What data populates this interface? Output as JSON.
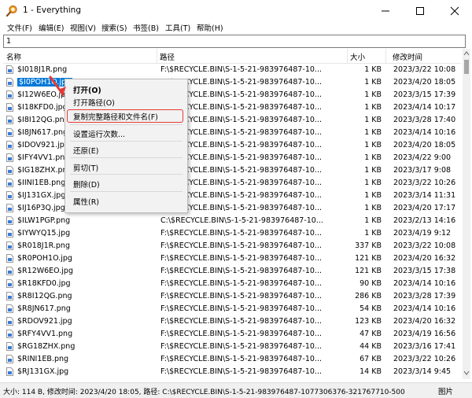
{
  "window": {
    "title": "1 - Everything"
  },
  "menu": [
    "文件(F)",
    "编辑(E)",
    "视图(V)",
    "搜索(S)",
    "书签(B)",
    "工具(T)",
    "帮助(H)"
  ],
  "search": {
    "value": "1"
  },
  "columns": {
    "name": "名称",
    "path": "路径",
    "size": "大小",
    "modified": "修改时间"
  },
  "rows": [
    {
      "name": "$I018J1R.png",
      "path": "F:\\$RECYCLE.BIN\\S-1-5-21-983976487-10...",
      "size": "1 KB",
      "date": "2023/3/22 10:08"
    },
    {
      "name": "$I0POH1O.jpg",
      "path": "F:\\$RECYCLE.BIN\\S-1-5-21-983976487-10...",
      "size": "1 KB",
      "date": "2023/4/20 18:05",
      "selected": true
    },
    {
      "name": "$I12W6EO.jpg",
      "path": "F:\\$RECYCLE.BIN\\S-1-5-21-983976487-10...",
      "size": "1 KB",
      "date": "2023/3/15 17:39"
    },
    {
      "name": "$I18KFD0.jpg",
      "path": "F:\\$RECYCLE.BIN\\S-1-5-21-983976487-10...",
      "size": "1 KB",
      "date": "2023/4/14 10:17"
    },
    {
      "name": "$I8I12QG.png",
      "path": "F:\\$RECYCLE.BIN\\S-1-5-21-983976487-10...",
      "size": "1 KB",
      "date": "2023/3/28 17:40"
    },
    {
      "name": "$I8JN617.png",
      "path": "F:\\$RECYCLE.BIN\\S-1-5-21-983976487-10...",
      "size": "1 KB",
      "date": "2023/4/14 10:16"
    },
    {
      "name": "$IDOV921.jpg",
      "path": "F:\\$RECYCLE.BIN\\S-1-5-21-983976487-10...",
      "size": "1 KB",
      "date": "2023/4/20 18:05"
    },
    {
      "name": "$IFY4VV1.png",
      "path": "F:\\$RECYCLE.BIN\\S-1-5-21-983976487-10...",
      "size": "1 KB",
      "date": "2023/4/22 9:00"
    },
    {
      "name": "$IG18ZHX.png",
      "path": "F:\\$RECYCLE.BIN\\S-1-5-21-983976487-10...",
      "size": "1 KB",
      "date": "2023/3/17 9:08"
    },
    {
      "name": "$IINI1EB.png",
      "path": "F:\\$RECYCLE.BIN\\S-1-5-21-983976487-10...",
      "size": "1 KB",
      "date": "2023/3/22 10:26"
    },
    {
      "name": "$IJ131GX.jpg",
      "path": "F:\\$RECYCLE.BIN\\S-1-5-21-983976487-10...",
      "size": "1 KB",
      "date": "2023/3/14 11:31"
    },
    {
      "name": "$IJ16P3Q.jpg",
      "path": "F:\\$RECYCLE.BIN\\S-1-5-21-983976487-10...",
      "size": "1 KB",
      "date": "2023/4/20 17:17"
    },
    {
      "name": "$ILW1PGP.png",
      "path": "C:\\$RECYCLE.BIN\\S-1-5-21-983976487-10...",
      "size": "1 KB",
      "date": "2023/2/13 14:16"
    },
    {
      "name": "$IYWYQ15.jpg",
      "path": "F:\\$RECYCLE.BIN\\S-1-5-21-983976487-10...",
      "size": "1 KB",
      "date": "2023/4/19 9:12"
    },
    {
      "name": "$R018J1R.png",
      "path": "F:\\$RECYCLE.BIN\\S-1-5-21-983976487-10...",
      "size": "337 KB",
      "date": "2023/3/22 10:08"
    },
    {
      "name": "$R0POH1O.jpg",
      "path": "F:\\$RECYCLE.BIN\\S-1-5-21-983976487-10...",
      "size": "121 KB",
      "date": "2023/4/20 16:32"
    },
    {
      "name": "$R12W6EO.jpg",
      "path": "F:\\$RECYCLE.BIN\\S-1-5-21-983976487-10...",
      "size": "121 KB",
      "date": "2023/3/15 17:38"
    },
    {
      "name": "$R18KFD0.jpg",
      "path": "F:\\$RECYCLE.BIN\\S-1-5-21-983976487-10...",
      "size": "90 KB",
      "date": "2023/4/14 10:16"
    },
    {
      "name": "$R8I12QG.png",
      "path": "F:\\$RECYCLE.BIN\\S-1-5-21-983976487-10...",
      "size": "286 KB",
      "date": "2023/3/28 17:39"
    },
    {
      "name": "$R8JN617.png",
      "path": "F:\\$RECYCLE.BIN\\S-1-5-21-983976487-10...",
      "size": "54 KB",
      "date": "2023/4/14 10:16"
    },
    {
      "name": "$RDOV921.jpg",
      "path": "F:\\$RECYCLE.BIN\\S-1-5-21-983976487-10...",
      "size": "123 KB",
      "date": "2023/4/20 16:32"
    },
    {
      "name": "$RFY4VV1.png",
      "path": "F:\\$RECYCLE.BIN\\S-1-5-21-983976487-10...",
      "size": "47 KB",
      "date": "2023/4/19 16:56"
    },
    {
      "name": "$RG18ZHX.png",
      "path": "F:\\$RECYCLE.BIN\\S-1-5-21-983976487-10...",
      "size": "44 KB",
      "date": "2023/3/16 17:41"
    },
    {
      "name": "$RINI1EB.png",
      "path": "F:\\$RECYCLE.BIN\\S-1-5-21-983976487-10...",
      "size": "67 KB",
      "date": "2023/3/22 10:26"
    },
    {
      "name": "$RJ131GX.jpg",
      "path": "F:\\$RECYCLE.BIN\\S-1-5-21-983976487-10...",
      "size": "14 KB",
      "date": "2023/3/14 9:45"
    },
    {
      "name": "",
      "path": "",
      "size": "",
      "date": ""
    }
  ],
  "context_menu": {
    "items": [
      "打开(O)",
      "打开路径(O)",
      "复制完整路径和文件名(F)",
      "设置运行次数...",
      "还原(E)",
      "剪切(T)",
      "删除(D)",
      "属性(R)"
    ]
  },
  "status": {
    "text": "大小: 114 B, 修改时间: 2023/4/20 18:05, 路径: C:\\$RECYCLE.BIN\\S-1-5-21-983976487-1077306376-321767710-500",
    "right": "图片"
  },
  "colors": {
    "selection": "#0078d7",
    "highlight": "#e53935"
  }
}
